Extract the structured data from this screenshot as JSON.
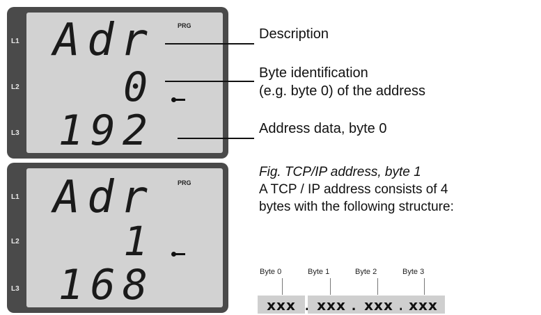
{
  "displays": [
    {
      "rows": [
        {
          "label": "L1",
          "value": "Adr"
        },
        {
          "label": "L2",
          "value": "0"
        },
        {
          "label": "L3",
          "value": "192"
        }
      ],
      "badge": "PRG"
    },
    {
      "rows": [
        {
          "label": "L1",
          "value": "Adr"
        },
        {
          "label": "L2",
          "value": "1"
        },
        {
          "label": "L3",
          "value": "168"
        }
      ],
      "badge": "PRG"
    }
  ],
  "annotations": {
    "description": "Description",
    "byte_id_line1": "Byte identification",
    "byte_id_line2": "(e.g. byte 0) of the address",
    "address_data": "Address data, byte 0"
  },
  "caption": {
    "title": "Fig. TCP/IP address, byte 1",
    "line1": "A TCP / IP address consists of 4",
    "line2": "bytes with the following structure:"
  },
  "structure": {
    "byte_labels": [
      "Byte 0",
      "Byte 1",
      "Byte 2",
      "Byte 3"
    ],
    "octets": [
      "xxx",
      "xxx",
      "xxx",
      "xxx"
    ],
    "separator": "."
  }
}
